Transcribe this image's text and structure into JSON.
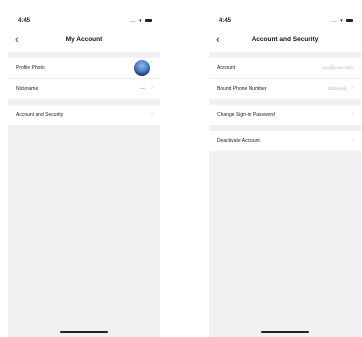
{
  "left_screen": {
    "status": {
      "time": "4:45"
    },
    "nav": {
      "back_icon": "chevron-left-icon",
      "title": "My Account"
    },
    "rows": {
      "profile_photo": {
        "label": "Profile Photo"
      },
      "nickname": {
        "label": "Nickname",
        "value": "•••"
      },
      "account_security": {
        "label": "Account and Security"
      }
    }
  },
  "right_screen": {
    "status": {
      "time": "4:45"
    },
    "nav": {
      "back_icon": "chevron-left-icon",
      "title": "Account and Security"
    },
    "rows": {
      "account": {
        "label": "Account",
        "value": "xxx@xxxx.com"
      },
      "bound_phone": {
        "label": "Bound Phone Number",
        "value": "Unbound"
      },
      "change_password": {
        "label": "Change Sign-in Password"
      },
      "deactivate": {
        "label": "Deactivate Account"
      }
    }
  },
  "colors": {
    "background": "#f1f1f3",
    "row_background": "#ffffff",
    "secondary_text": "#b5b5b5"
  }
}
